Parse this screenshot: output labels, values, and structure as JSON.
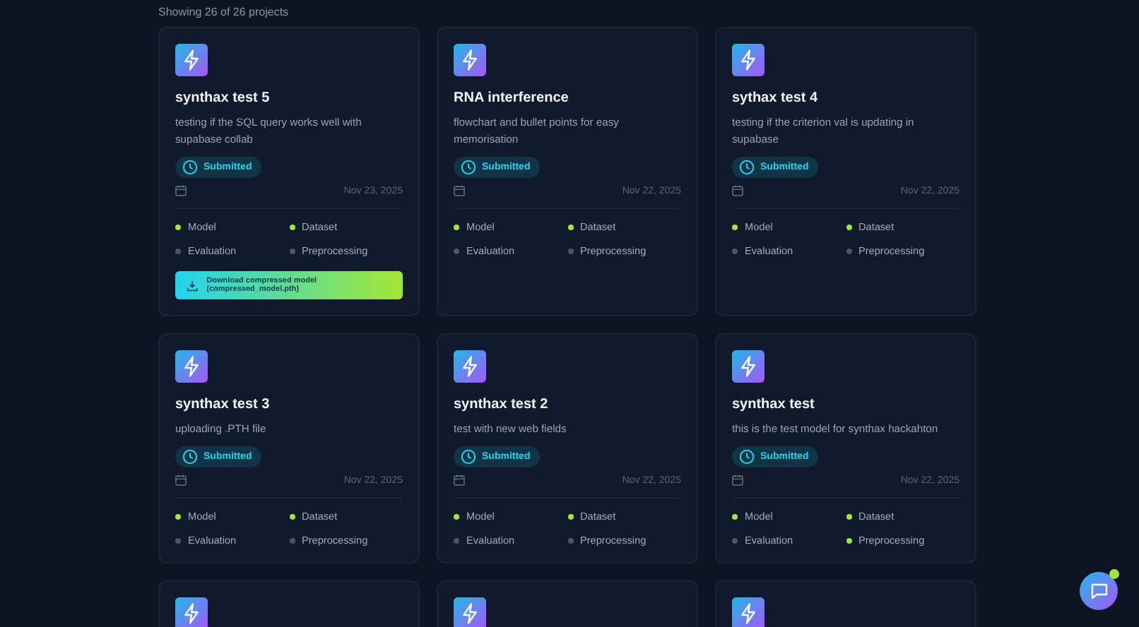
{
  "summary": "Showing 26 of 26 projects",
  "projects": [
    {
      "kind": "project",
      "title": "synthax test 5",
      "description": "testing if the SQL query works well with supabase collab",
      "status": "Submitted",
      "date": "Nov 23, 2025",
      "stages": [
        {
          "label": "Model",
          "done": true
        },
        {
          "label": "Dataset",
          "done": true
        },
        {
          "label": "Evaluation",
          "done": false
        },
        {
          "label": "Preprocessing",
          "done": false
        }
      ],
      "download": "Download compressed model (compressed_model.pth)"
    },
    {
      "kind": "project",
      "title": "RNA interference",
      "description": "flowchart and bullet points for easy memorisation",
      "status": "Submitted",
      "date": "Nov 22, 2025",
      "stages": [
        {
          "label": "Model",
          "done": true
        },
        {
          "label": "Dataset",
          "done": true
        },
        {
          "label": "Evaluation",
          "done": false
        },
        {
          "label": "Preprocessing",
          "done": false
        }
      ]
    },
    {
      "kind": "project",
      "title": "sythax test 4",
      "description": "testing if the criterion val is updating in supabase",
      "status": "Submitted",
      "date": "Nov 22, 2025",
      "stages": [
        {
          "label": "Model",
          "done": true
        },
        {
          "label": "Dataset",
          "done": true
        },
        {
          "label": "Evaluation",
          "done": false
        },
        {
          "label": "Preprocessing",
          "done": false
        }
      ]
    },
    {
      "kind": "project",
      "title": "synthax test 3",
      "description": "uploading .PTH file",
      "status": "Submitted",
      "date": "Nov 22, 2025",
      "stages": [
        {
          "label": "Model",
          "done": true
        },
        {
          "label": "Dataset",
          "done": true
        },
        {
          "label": "Evaluation",
          "done": false
        },
        {
          "label": "Preprocessing",
          "done": false
        }
      ]
    },
    {
      "kind": "project",
      "title": "synthax test 2",
      "description": "test with new web fields",
      "status": "Submitted",
      "date": "Nov 22, 2025",
      "stages": [
        {
          "label": "Model",
          "done": true
        },
        {
          "label": "Dataset",
          "done": true
        },
        {
          "label": "Evaluation",
          "done": false
        },
        {
          "label": "Preprocessing",
          "done": false
        }
      ]
    },
    {
      "kind": "project",
      "title": "synthax test",
      "description": "this is the test model for synthax hackahton",
      "status": "Submitted",
      "date": "Nov 22, 2025",
      "stages": [
        {
          "label": "Model",
          "done": true
        },
        {
          "label": "Dataset",
          "done": true
        },
        {
          "label": "Evaluation",
          "done": false
        },
        {
          "label": "Preprocessing",
          "done": true
        }
      ]
    },
    {
      "kind": "clipped"
    },
    {
      "kind": "clipped"
    },
    {
      "kind": "clipped"
    }
  ],
  "chat": {
    "unread": true
  }
}
